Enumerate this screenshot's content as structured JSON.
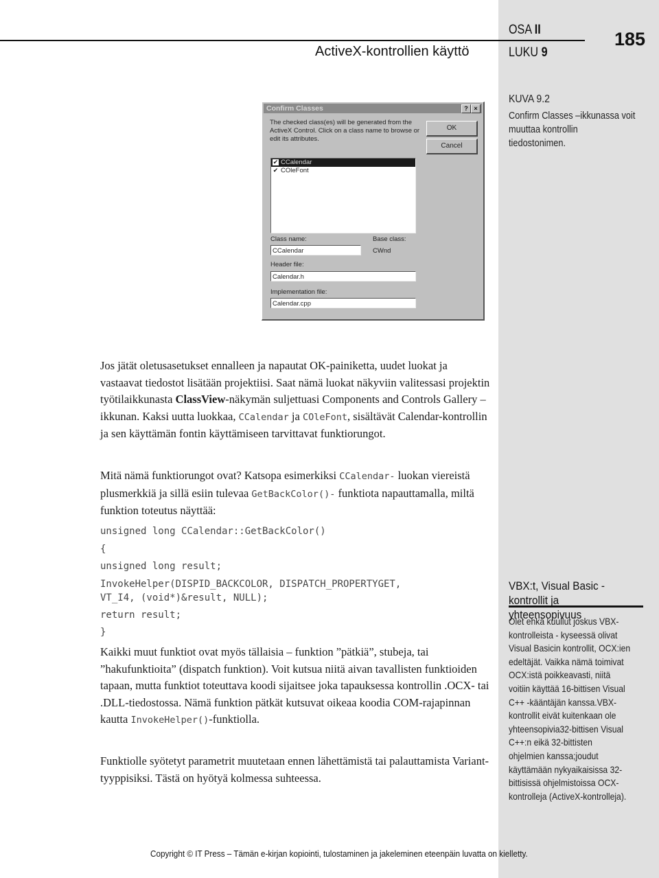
{
  "header": {
    "chapter_title": "ActiveX-kontrollien käyttö",
    "part_label": "OSA",
    "part_value": "II",
    "chapter_label": "LUKU",
    "chapter_value": "9",
    "page_number": "185"
  },
  "figure": {
    "label": "KUVA 9.2",
    "caption": "Confirm Classes –ikkunassa voit muuttaa kontrollin tiedostonimen."
  },
  "dialog": {
    "title": "Confirm Classes",
    "help_button": "?",
    "close_button": "×",
    "description": "The checked class(es) will be generated from the ActiveX Control. Click on a class name to browse or edit its attributes.",
    "ok_label": "OK",
    "cancel_label": "Cancel",
    "classes": [
      {
        "name": "CCalendar",
        "checked": true,
        "selected": true
      },
      {
        "name": "COleFont",
        "checked": true,
        "selected": false
      }
    ],
    "class_name_label": "Class name:",
    "class_name_value": "CCalendar",
    "base_class_label": "Base class:",
    "base_class_value": "CWnd",
    "header_file_label": "Header file:",
    "header_file_value": "Calendar.h",
    "impl_file_label": "Implementation file:",
    "impl_file_value": "Calendar.cpp"
  },
  "body": {
    "p1": {
      "a": "Jos jätät oletusasetukset ennalleen ja napautat OK-painiketta, uudet luokat ja vastaavat tiedostot lisätään projektiisi. Saat nämä luokat näkyviin valitessasi projektin työtilaikkunasta ",
      "b": "ClassView",
      "c": "-näkymän suljettuasi Components and Controls Gallery –ikkunan. Kaksi uutta luokkaa, ",
      "code1": "CCalendar",
      "d": " ja ",
      "code2": "COleFont",
      "e": ", sisältävät Calendar-kontrollin ja sen käyttämän fontin käyttämiseen tarvittavat funktiorungot."
    },
    "p2": {
      "a": "Mitä nämä funktiorungot ovat? Katsopa esimerkiksi ",
      "code1": "CCalendar-",
      "b": " luokan viereistä plusmerkkiä ja sillä esiin tulevaa ",
      "code2": "GetBackColor()-",
      "c": " funktiota napauttamalla, miltä funktion toteutus näyttää:"
    },
    "code": [
      "unsigned long CCalendar::GetBackColor()",
      "{",
      "unsigned long result;",
      "InvokeHelper(DISPID_BACKCOLOR, DISPATCH_PROPERTYGET,\nVT_I4, (void*)&result, NULL);",
      "return result;",
      "}"
    ],
    "p3": {
      "a": "Kaikki muut funktiot ovat myös tällaisia – funktion ”pätkiä”, stubeja, tai ”hakufunktioita” (dispatch funktion). Voit kutsua niitä aivan tavallisten funktioiden tapaan, mutta funktiot toteuttava koodi sijaitsee joka tapauksessa kontrollin .OCX- tai .DLL-tiedostossa. Nämä funktion pätkät kutsuvat oikeaa koodia COM-rajapinnan kautta ",
      "code1": "InvokeHelper()",
      "b": "-funktiolla."
    },
    "p4": "Funktiolle syötetyt parametrit muutetaan ennen lähettämistä tai palauttamista Variant-tyyppisiksi. Tästä on hyötyä kolmessa suhteessa."
  },
  "sidebar": {
    "title_line1": "VBX:t, Visual Basic -",
    "title_line2": "kontrollit ja yhteensopivuus",
    "lines": [
      "Olet ehkä kuullut joskus VBX-",
      "kontrolleista - kyseessä olivat",
      "Visual Basicin kontrollit, OCX:ien",
      "edeltäjät. Vaikka nämä toimivat",
      "OCX:istä poikkeavasti, niitä",
      "voitiin käyttää 16-bittisen Visual",
      "C++ -kääntäjän kanssa.VBX-",
      "kontrollit eivät kuitenkaan ole",
      "yhteensopivia32-bittisen Visual",
      "C++:n eikä 32-bittisten",
      "ohjelmien kanssa;joudut",
      "käyttämään nykyaikaisissa 32-",
      "bittisissä ohjelmistoissa OCX-",
      "kontrolleja (ActiveX-kontrolleja)."
    ]
  },
  "footer": {
    "copyright": "Copyright © IT Press – Tämän e-kirjan kopiointi, tulostaminen ja jakeleminen eteenpäin luvatta on kielletty."
  }
}
